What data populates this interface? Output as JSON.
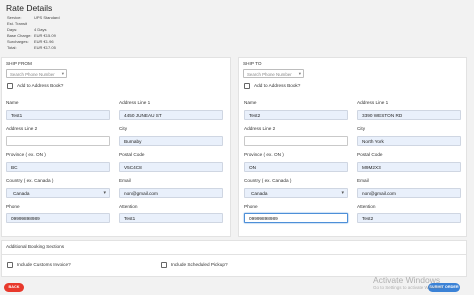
{
  "rate_details": {
    "title": "Rate Details",
    "rows": [
      {
        "label": "Service:",
        "value": "UPS Standard"
      },
      {
        "label": "Est. Transit Days:",
        "value": "4 Days"
      },
      {
        "label": "Base Charge:",
        "value": "EUR €15.09"
      },
      {
        "label": "Surcharges:",
        "value": "EUR €1.96"
      },
      {
        "label": "Total:",
        "value": "EUR €17.05"
      }
    ]
  },
  "ship_from": {
    "title": "SHIP FROM",
    "search_placeholder": "Search Phone Number",
    "address_book_label": "Add to Address Book?",
    "name_label": "Name",
    "name_value": "Test1",
    "address1_label": "Address Line 1",
    "address1_value": "4450 JUNEAU ST",
    "address2_label": "Address Line 2",
    "address2_value": "",
    "city_label": "City",
    "city_value": "Burnaby",
    "province_label": "Province ( ex. ON )",
    "province_value": "BC",
    "postal_label": "Postal Code",
    "postal_value": "V5C4C8",
    "country_label": "Country ( ex. Canada )",
    "country_value": "Canada",
    "email_label": "Email",
    "email_value": "non@gmail.com",
    "phone_label": "Phone",
    "phone_value": "09999898989",
    "attention_label": "Attention",
    "attention_value": "Test1"
  },
  "ship_to": {
    "title": "SHIP TO",
    "search_placeholder": "Search Phone Number",
    "address_book_label": "Add to Address Book?",
    "name_label": "Name",
    "name_value": "Test2",
    "address1_label": "Address Line 1",
    "address1_value": "3390 WESTON RD",
    "address2_label": "Address Line 2",
    "address2_value": "",
    "city_label": "City",
    "city_value": "North York",
    "province_label": "Province ( ex. ON )",
    "province_value": "ON",
    "postal_label": "Postal Code",
    "postal_value": "M9M2X3",
    "country_label": "Country ( ex. Canada )",
    "country_value": "Canada",
    "email_label": "Email",
    "email_value": "non@gmail.com",
    "phone_label": "Phone",
    "phone_value": "09999898989",
    "attention_label": "Attention",
    "attention_value": "Test2"
  },
  "additional": {
    "title": "Additional Booking Sections",
    "customs_label": "Include Customs Invoice?",
    "pickup_label": "Include Scheduled Pickup?"
  },
  "buttons": {
    "back": "BACK",
    "submit": "SUBMIT ORDER"
  },
  "watermark": {
    "title": "Activate Windows",
    "subtitle": "Go to Settings to activate Windows."
  },
  "colors": {
    "back": "#e8392c",
    "submit": "#3b82d6",
    "field": "#e9f0fb"
  }
}
